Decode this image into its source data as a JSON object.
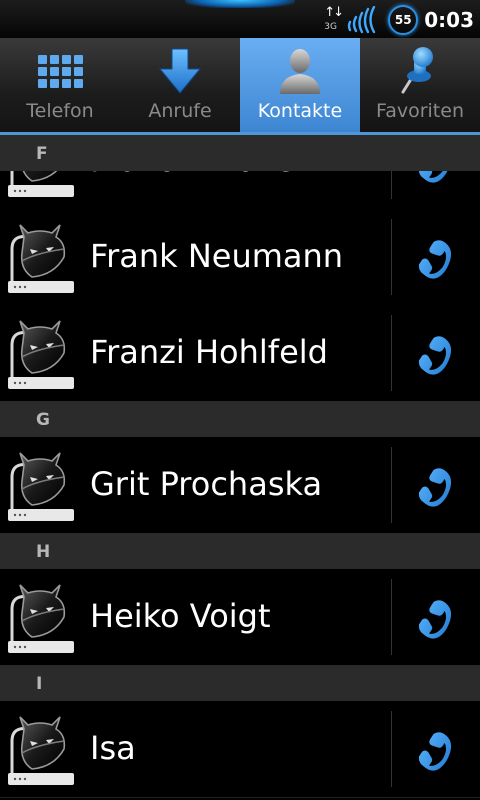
{
  "status": {
    "network": "3G",
    "battery": "55",
    "time": "0:03"
  },
  "tabs": [
    {
      "label": "Telefon",
      "icon": "dialpad-grid-icon",
      "active": false
    },
    {
      "label": "Anrufe",
      "icon": "call-log-arrow-icon",
      "active": false
    },
    {
      "label": "Kontakte",
      "icon": "contacts-person-icon",
      "active": true
    },
    {
      "label": "Favoriten",
      "icon": "favorites-pin-icon",
      "active": false
    }
  ],
  "sections": [
    {
      "letter": "F"
    },
    {
      "letter": "G"
    },
    {
      "letter": "H"
    },
    {
      "letter": "I"
    }
  ],
  "contacts": [
    {
      "name": "Florian Müller"
    },
    {
      "name": "Frank Neumann"
    },
    {
      "name": "Franzi Hohlfeld"
    },
    {
      "name": "Grit Prochaska"
    },
    {
      "name": "Heiko Voigt"
    },
    {
      "name": "Isa"
    }
  ],
  "colors": {
    "accent": "#3d86d2",
    "call_icon": "#2e8ee4",
    "section_bg": "#2b2b2b"
  }
}
